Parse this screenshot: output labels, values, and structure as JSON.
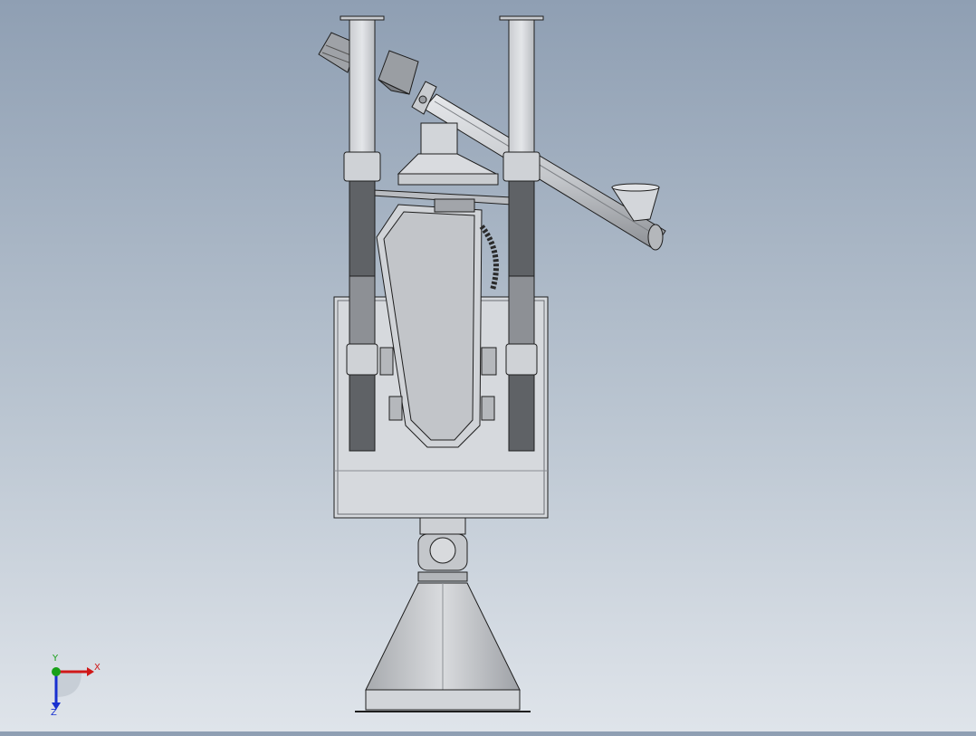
{
  "viewport": {
    "background_top": "#8f9fb3",
    "background_bottom": "#dfe4ea"
  },
  "model": {
    "line_color": "#1e1e1e",
    "body_color": "#d7dade",
    "shade_color": "#5f6266",
    "dark_color": "#3c3f44"
  },
  "triad": {
    "x_label": "X",
    "y_label": "Y",
    "z_label": "Z",
    "x_color": "#d01818",
    "y_color": "#18a018",
    "z_color": "#1830d0"
  }
}
